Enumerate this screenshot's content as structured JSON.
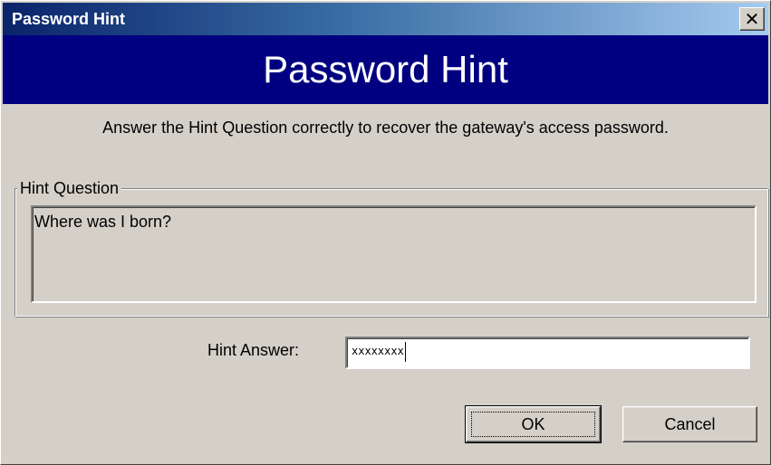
{
  "window": {
    "title": "Password Hint",
    "close_icon": "close-icon"
  },
  "banner": {
    "heading": "Password Hint"
  },
  "instruction": "Answer the Hint Question correctly to recover the gateway's access password.",
  "hint_question": {
    "group_label": "Hint Question",
    "question": "Where was I born?"
  },
  "hint_answer": {
    "label": "Hint Answer:",
    "value": "xxxxxxxx"
  },
  "buttons": {
    "ok_label": "OK",
    "cancel_label": "Cancel"
  },
  "colors": {
    "title_gradient_start": "#0a246a",
    "title_gradient_end": "#a6caf0",
    "banner_bg": "#000080",
    "dialog_bg": "#d4d0c8"
  }
}
